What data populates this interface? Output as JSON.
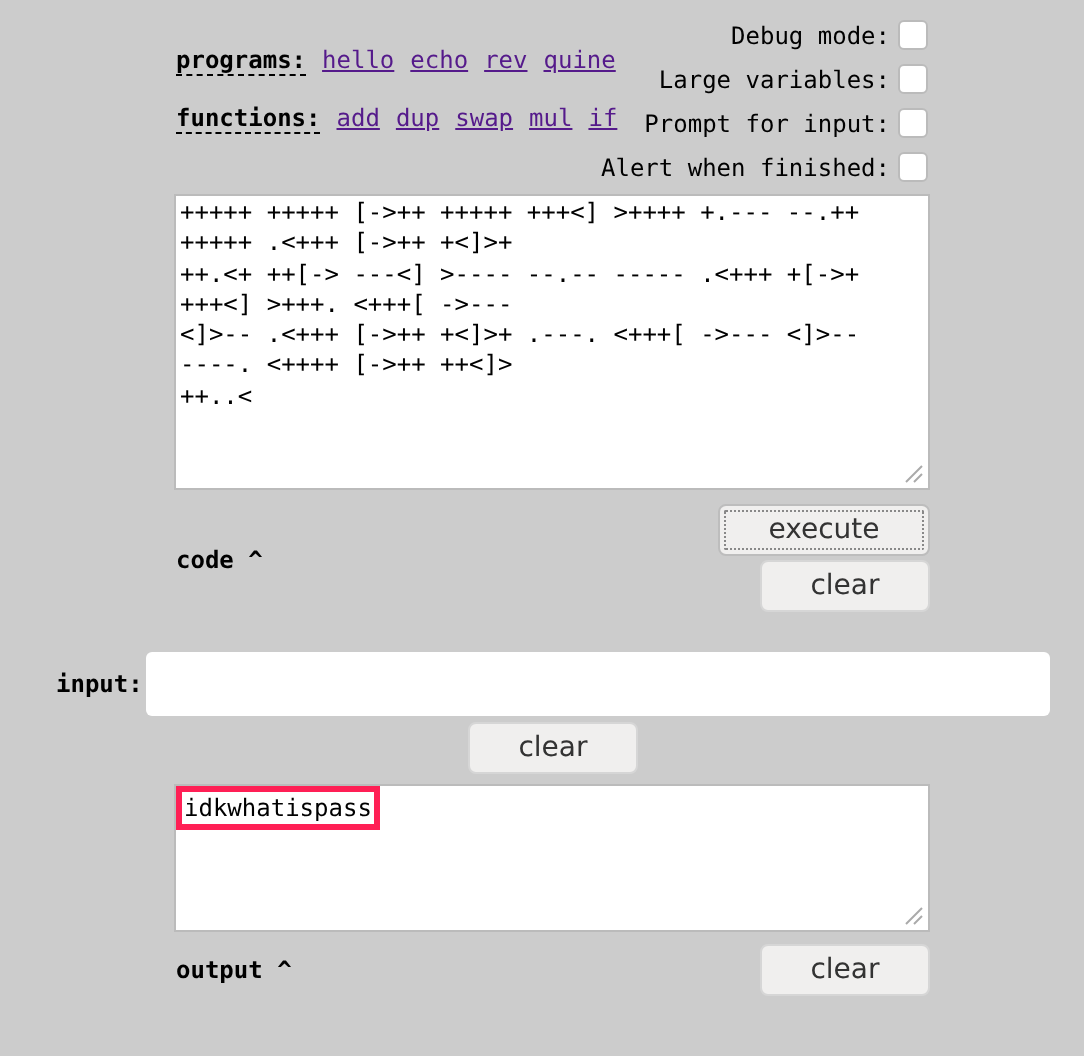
{
  "programs": {
    "label": "programs:",
    "links": [
      "hello",
      "echo",
      "rev",
      "quine"
    ]
  },
  "functions": {
    "label": "functions:",
    "links": [
      "add",
      "dup",
      "swap",
      "mul",
      "if"
    ]
  },
  "options": [
    {
      "label": "Debug mode:",
      "checked": false
    },
    {
      "label": "Large variables:",
      "checked": false
    },
    {
      "label": "Prompt for input:",
      "checked": false
    },
    {
      "label": "Alert when finished:",
      "checked": false
    }
  ],
  "code": {
    "lines": [
      "+++++ +++++ [->++ +++++ +++<] >++++ +.--- --.++",
      "+++++ .<+++ [->++ +<]>+",
      "++.<+ ++[-> ---<] >---- --.-- ----- .<+++ +[->+",
      "+++<] >+++. <+++[ ->---",
      "<]>-- .<+++ [->++ +<]>+ .---. <+++[ ->--- <]>--",
      "----. <++++ [->++ ++<]>",
      "++..<"
    ],
    "label": "code ^",
    "execute": "execute",
    "clear": "clear"
  },
  "input": {
    "label": "input:",
    "clear": "clear"
  },
  "output": {
    "text": "idkwhatispass",
    "highlighted": true,
    "label": "output ^",
    "clear": "clear"
  }
}
